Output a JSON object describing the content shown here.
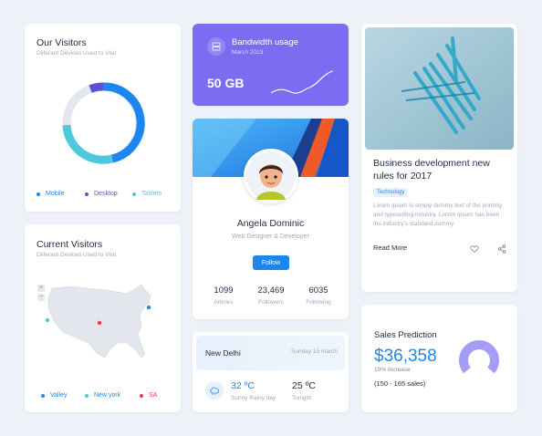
{
  "visitors": {
    "title": "Our Visitors",
    "subtitle": "Diiferant Devices Used to Visit",
    "legend": [
      {
        "label": "Mobile",
        "color": "#1e86f0"
      },
      {
        "label": "Desktop",
        "color": "#5b4fd6"
      },
      {
        "label": "Tablets",
        "color": "#4dc8dd"
      }
    ],
    "donut_colors": {
      "mobile": "#1e86f0",
      "desktop": "#5b4fd6",
      "tablets": "#4dc8dd",
      "empty": "#e4e7ee"
    }
  },
  "current_visitors": {
    "title": "Current Visitors",
    "subtitle": "Diiferant Devices Used to Visit",
    "zoom_in": "+",
    "zoom_out": "−",
    "legend": [
      {
        "label": "Valley",
        "color": "#1e86f0"
      },
      {
        "label": "New york",
        "color": "#4dc8dd"
      },
      {
        "label": "SA",
        "color": "#f0364a"
      }
    ]
  },
  "bandwidth": {
    "title": "Bandwidth usage",
    "subtitle": "March 2023",
    "value": "50 GB"
  },
  "profile": {
    "name": "Angela Dominic",
    "role": "Web Designer & Developer",
    "follow_label": "Follow",
    "stats": [
      {
        "value": "1099",
        "label": "Articles"
      },
      {
        "value": "23,469",
        "label": "Followers"
      },
      {
        "value": "6035",
        "label": "Following"
      }
    ]
  },
  "weather": {
    "city": "New Delhi",
    "date": "Sunday 15 march",
    "temp1": "32 ºC",
    "desc1": "Sunny Rainy day",
    "temp2": "25 ºC",
    "desc2": "Tonight"
  },
  "blog": {
    "title": "Business development new rules for 2017",
    "tag": "Technology",
    "body": "Lorem ipsum is simply dummy text of the printing and typesetting industry. Lorem Ipsum has been the industry's standard dummy",
    "read_more": "Read More"
  },
  "sales": {
    "title": "Sales Prediction",
    "value": "$36,358",
    "increase": "10% Increase",
    "range": "(150 - 165 sales)"
  }
}
